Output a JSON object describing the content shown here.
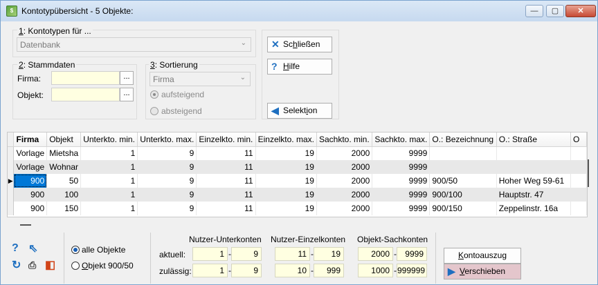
{
  "window": {
    "title": "Kontotypübersicht - 5 Objekte:",
    "min": "—",
    "max": "▢",
    "close": "✕"
  },
  "kontotypen": {
    "label_key": "1",
    "label_rest": ": Kontotypen für ...",
    "value": "Datenbank"
  },
  "stammdaten": {
    "label_key": "2",
    "label_rest": ": Stammdaten",
    "firma_label": "Firma:",
    "objekt_label": "Objekt:",
    "browse": "..."
  },
  "sortierung": {
    "label_key": "3",
    "label_rest": ": Sortierung",
    "value": "Firma",
    "asc": "aufsteigend",
    "desc": "absteigend"
  },
  "buttons": {
    "schliessen_u": "Sc",
    "schliessen_key": "h",
    "schliessen_rest": "ließen",
    "hilfe_key": "H",
    "hilfe_rest": "ilfe",
    "selektion_pre": "Selekt",
    "selektion_key": "i",
    "selektion_rest": "on"
  },
  "grid": {
    "columns": [
      "Firma",
      "Objekt",
      "Unterkto. min.",
      "Unterkto. max.",
      "Einzelkto. min.",
      "Einzelkto. max.",
      "Sachkto. min.",
      "Sachkto. max.",
      "O.: Bezeichnung",
      "O.: Straße",
      "O"
    ],
    "rows": [
      {
        "ind": "",
        "cells": [
          "Vorlage",
          "Mietsha",
          "1",
          "9",
          "11",
          "19",
          "2000",
          "9999",
          "",
          "",
          ""
        ]
      },
      {
        "ind": "",
        "cells": [
          "Vorlage",
          "Wohnar",
          "1",
          "9",
          "11",
          "19",
          "2000",
          "9999",
          "",
          "",
          ""
        ]
      },
      {
        "ind": "▶",
        "cells": [
          "900",
          "50",
          "1",
          "9",
          "11",
          "19",
          "2000",
          "9999",
          "900/50",
          "Hoher Weg 59-61",
          ""
        ]
      },
      {
        "ind": "",
        "cells": [
          "900",
          "100",
          "1",
          "9",
          "11",
          "19",
          "2000",
          "9999",
          "900/100",
          "Hauptstr. 47",
          ""
        ]
      },
      {
        "ind": "",
        "cells": [
          "900",
          "150",
          "1",
          "9",
          "11",
          "19",
          "2000",
          "9999",
          "900/150",
          "Zeppelinstr. 16a",
          ""
        ]
      }
    ]
  },
  "filter": {
    "alle": "alle Objekte",
    "objekt_key": "O",
    "objekt_rest": "bjekt 900/50"
  },
  "limits": {
    "h_unter": "Nutzer-Unterkonten",
    "h_einzel": "Nutzer-Einzelkonten",
    "h_sach": "Objekt-Sachkonten",
    "aktuell": "aktuell:",
    "zulaessig": "zulässig:",
    "dash": "-",
    "aktuell_vals": [
      "1",
      "9",
      "11",
      "19",
      "2000",
      "9999"
    ],
    "zulaessig_vals": [
      "1",
      "9",
      "10",
      "999",
      "1000",
      "999999"
    ]
  },
  "actions": {
    "kontoauszug_key": "K",
    "kontoauszug_rest": "ontoauszug",
    "verschieben_key": "V",
    "verschieben_rest": "erschieben"
  },
  "colors": {
    "accent": "#0078d7",
    "field_bg": "#ffffe1",
    "verschieben_bg": "#e4c6cc"
  }
}
